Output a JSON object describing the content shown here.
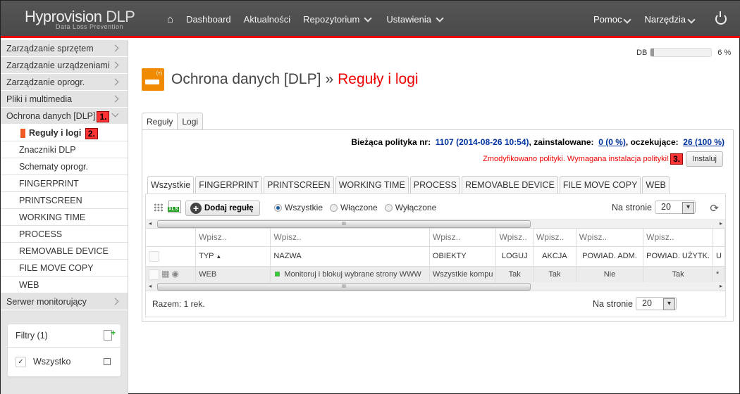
{
  "header": {
    "logo_main": "Hyprovision",
    "logo_dlp": "DLP",
    "logo_sub": "Data Loss Prevention",
    "nav": [
      {
        "label": "Dashboard"
      },
      {
        "label": "Aktualności"
      },
      {
        "label": "Repozytorium"
      },
      {
        "label": "Ustawienia"
      }
    ],
    "right_nav": [
      {
        "label": "Pomoc"
      },
      {
        "label": "Narzędzia"
      }
    ],
    "accent_color": "#e00000"
  },
  "sidebar": {
    "items": [
      {
        "label": "Zarządzanie sprzętem"
      },
      {
        "label": "Zarządzanie urządzeniami"
      },
      {
        "label": "Zarządzanie oprogr."
      },
      {
        "label": "Pliki i multimedia"
      },
      {
        "label": "Ochrona danych [DLP]",
        "badge": "1."
      }
    ],
    "subitems": [
      {
        "label": "Reguły i logi",
        "badge": "2."
      },
      {
        "label": "Znaczniki DLP"
      },
      {
        "label": "Schematy oprogr."
      },
      {
        "label": "FINGERPRINT"
      },
      {
        "label": "PRINTSCREEN"
      },
      {
        "label": "WORKING TIME"
      },
      {
        "label": "PROCESS"
      },
      {
        "label": "REMOVABLE DEVICE"
      },
      {
        "label": "FILE MOVE COPY"
      },
      {
        "label": "WEB"
      }
    ],
    "last_item": {
      "label": "Serwer monitorujący"
    },
    "filters": {
      "title": "Filtry (1)",
      "items": [
        {
          "label": "Wszystko",
          "checked": true
        }
      ]
    }
  },
  "db_usage": {
    "label": "DB",
    "percent": 6,
    "percent_text": "6 %"
  },
  "page": {
    "title_section": "Ochrona danych [DLP]",
    "separator": "»",
    "title_page": "Reguły i logi",
    "tabs": [
      {
        "label": "Reguły"
      },
      {
        "label": "Logi"
      }
    ],
    "policy": {
      "label": "Bieżąca polityka nr:",
      "value": "1107 (2014-08-26 10:54)",
      "installed_label": ", zainstalowane:",
      "installed_value": "0 (0 %)",
      "pending_label": ", oczekujące:",
      "pending_value": "26 (100 %)"
    },
    "warning": "Zmodyfikowano polityki. Wymagana instalacja polityki!",
    "warning_badge": "3.",
    "install_button": "Instaluj"
  },
  "rules": {
    "type_tabs": [
      {
        "label": "Wszystkie"
      },
      {
        "label": "FINGERPRINT"
      },
      {
        "label": "PRINTSCREEN"
      },
      {
        "label": "WORKING TIME"
      },
      {
        "label": "PROCESS"
      },
      {
        "label": "REMOVABLE DEVICE"
      },
      {
        "label": "FILE MOVE COPY"
      },
      {
        "label": "WEB"
      }
    ],
    "xls_label": "XLS",
    "add_button": "Dodaj regułę",
    "radios": [
      {
        "label": "Wszystkie",
        "checked": true
      },
      {
        "label": "Włączone",
        "checked": false
      },
      {
        "label": "Wyłączone",
        "checked": false
      }
    ],
    "per_page_label": "Na stronie",
    "per_page_value": "20",
    "filter_placeholder": "Wpisz..",
    "columns": [
      "TYP",
      "NAZWA",
      "OBIEKTY",
      "LOGUJ",
      "AKCJA",
      "POWIAD. ADM.",
      "POWIAD. UŻYTK.",
      "U"
    ],
    "rows": [
      {
        "typ": "WEB",
        "nazwa": "Monitoruj i blokuj wybrane strony WWW",
        "obiekty": "Wszystkie kompu",
        "loguj": "Tak",
        "akcja": "Tak",
        "powiad_adm": "Nie",
        "powiad_uzytk": "Tak",
        "u": "*"
      }
    ],
    "total": "Razem: 1 rek."
  }
}
